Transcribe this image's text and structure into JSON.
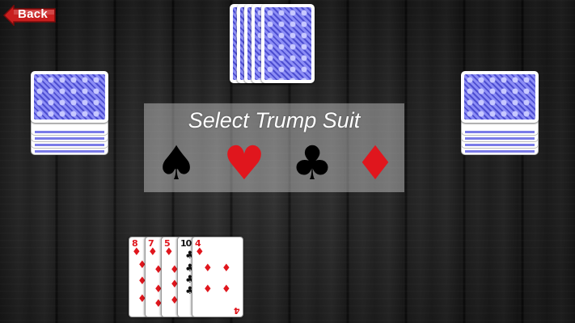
{
  "header": {
    "back_label": "Back"
  },
  "trump_selector": {
    "title": "Select Trump Suit",
    "suits": [
      {
        "name": "spades",
        "glyph": "♠",
        "color": "#000000"
      },
      {
        "name": "hearts",
        "glyph": "♥",
        "color": "#e0161d"
      },
      {
        "name": "clubs",
        "glyph": "♣",
        "color": "#000000"
      },
      {
        "name": "diamonds",
        "glyph": "♦",
        "color": "#e0161d"
      }
    ]
  },
  "player_hand": [
    {
      "rank": "8",
      "suit": "♦",
      "color": "red"
    },
    {
      "rank": "7",
      "suit": "♦",
      "color": "red"
    },
    {
      "rank": "5",
      "suit": "♦",
      "color": "red"
    },
    {
      "rank": "10",
      "suit": "♣",
      "color": "black"
    },
    {
      "rank": "4",
      "suit": "♦",
      "color": "red"
    }
  ],
  "opponents": {
    "top": {
      "cards": 5
    },
    "left": {
      "cards": 5
    },
    "right": {
      "cards": 5
    }
  },
  "colors": {
    "card_back": "#6d6ee8",
    "back_button": "#c81e1e"
  }
}
